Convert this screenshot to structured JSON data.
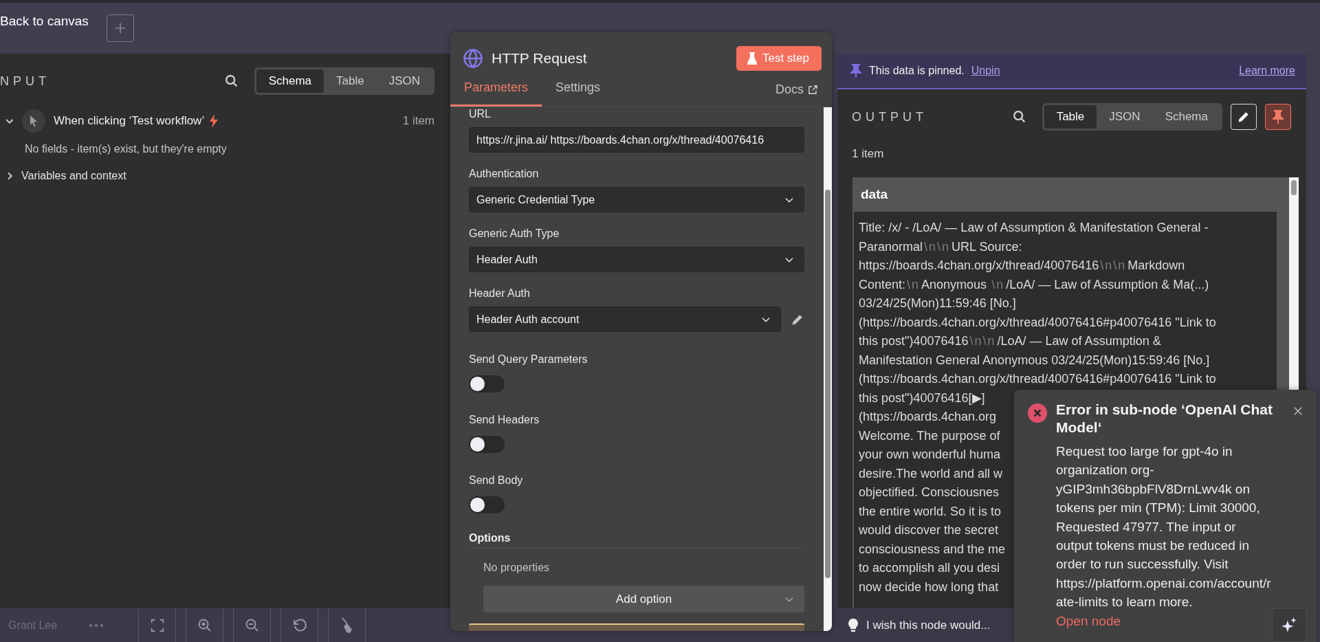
{
  "top_bar": {
    "back_link": "Back to canvas"
  },
  "input_panel": {
    "title": "NPUT",
    "view_tabs": [
      {
        "label": "Schema",
        "selected": true
      },
      {
        "label": "Table",
        "selected": false
      },
      {
        "label": "JSON",
        "selected": false
      }
    ],
    "nodes": [
      {
        "name": "When clicking ‘Test workflow’",
        "item_count": "1 item",
        "expanded": true,
        "message": "No fields - item(s) exist, but they're empty"
      }
    ],
    "sections": [
      {
        "label": "Variables and context",
        "expanded": false
      }
    ]
  },
  "node_panel": {
    "title": "HTTP Request",
    "test_button": "Test step",
    "tabs": [
      {
        "label": "Parameters",
        "selected": true
      },
      {
        "label": "Settings",
        "selected": false
      }
    ],
    "docs_link": "Docs",
    "parameters": [
      {
        "kind": "text",
        "label": "URL",
        "value": "https://r.jina.ai/ https://boards.4chan.org/x/thread/40076416"
      },
      {
        "kind": "select",
        "label": "Authentication",
        "value": "Generic Credential Type"
      },
      {
        "kind": "select",
        "label": "Generic Auth Type",
        "value": "Header Auth"
      },
      {
        "kind": "credential",
        "label": "Header Auth",
        "value": "Header Auth account"
      },
      {
        "kind": "toggle",
        "label": "Send Query Parameters",
        "on": false
      },
      {
        "kind": "toggle",
        "label": "Send Headers",
        "on": false
      },
      {
        "kind": "toggle",
        "label": "Send Body",
        "on": false
      }
    ],
    "options": {
      "label": "Options",
      "empty_text": "No properties",
      "add_button": "Add option"
    }
  },
  "output_panel": {
    "pin_notice": {
      "text": "This data is pinned.",
      "unpin_link": "Unpin",
      "learn_more_link": "Learn more"
    },
    "title": "OUTPUT",
    "view_tabs": [
      {
        "label": "Table",
        "selected": true
      },
      {
        "label": "JSON",
        "selected": false
      },
      {
        "label": "Schema",
        "selected": false
      }
    ],
    "pinned": true,
    "item_count": "1 item",
    "table": {
      "columns": [
        "data"
      ],
      "cell_lines": [
        [
          {
            "kind": "text",
            "text": "Title: /x/ - /LoA/ — Law of Assumption & Manifestation General -"
          }
        ],
        [
          {
            "kind": "text",
            "text": "Paranormal"
          },
          {
            "kind": "escape",
            "text": "\\n\\n"
          },
          {
            "kind": "text",
            "text": "URL Source:"
          }
        ],
        [
          {
            "kind": "text",
            "text": "https://boards.4chan.org/x/thread/40076416"
          },
          {
            "kind": "escape",
            "text": "\\n\\n"
          },
          {
            "kind": "text",
            "text": "Markdown"
          }
        ],
        [
          {
            "kind": "text",
            "text": "Content:"
          },
          {
            "kind": "escape",
            "text": "\\n"
          },
          {
            "kind": "text",
            "text": "Anonymous  "
          },
          {
            "kind": "escape",
            "text": "\\n"
          },
          {
            "kind": "text",
            "text": "/LoA/ — Law of Assumption & Ma(...)"
          }
        ],
        [
          {
            "kind": "text",
            "text": "03/24/25(Mon)11:59:46 [No.]"
          }
        ],
        [
          {
            "kind": "text",
            "text": "(https://boards.4chan.org/x/thread/40076416#p40076416 \"Link to"
          }
        ],
        [
          {
            "kind": "text",
            "text": "this post\")40076416"
          },
          {
            "kind": "escape",
            "text": "\\n\\n"
          },
          {
            "kind": "text",
            "text": "/LoA/ — Law of Assumption &"
          }
        ],
        [
          {
            "kind": "text",
            "text": "Manifestation General Anonymous 03/24/25(Mon)15:59:46 [No.]"
          }
        ],
        [
          {
            "kind": "text",
            "text": "(https://boards.4chan.org/x/thread/40076416#p40076416 \"Link to"
          }
        ],
        [
          {
            "kind": "text",
            "text": "this post\")40076416[▶]"
          }
        ],
        [
          {
            "kind": "text",
            "text": "(https://boards.4chan.org"
          }
        ],
        [
          {
            "kind": "text",
            "text": "Welcome. The purpose of"
          }
        ],
        [
          {
            "kind": "text",
            "text": "your own wonderful huma"
          }
        ],
        [
          {
            "kind": "text",
            "text": "desire.The world and all w"
          }
        ],
        [
          {
            "kind": "text",
            "text": "objectified. Consciousnes"
          }
        ],
        [
          {
            "kind": "text",
            "text": "the entire world. So it is to"
          }
        ],
        [
          {
            "kind": "text",
            "text": "would discover the secret"
          }
        ],
        [
          {
            "kind": "text",
            "text": "consciousness and the me"
          }
        ],
        [
          {
            "kind": "text",
            "text": "to accomplish all you desi"
          }
        ],
        [
          {
            "kind": "text",
            "text": "now decide how long that"
          }
        ]
      ]
    },
    "feedback_prompt": "I wish this node would..."
  },
  "error_toast": {
    "title": "Error in sub-node ‘OpenAI Chat Model‘",
    "message": "Request too large for gpt-4o in organization org-yGIP3mh36bpbFlV8DrnLwv4k on tokens per min (TPM): Limit 30000, Requested 47977. The input or output tokens must be reduced in order to run successfully. Visit https://platform.openai.com/account/rate-limits to learn more.",
    "link": "Open node"
  },
  "bottom_bar": {
    "user": "Grant Lee"
  }
}
